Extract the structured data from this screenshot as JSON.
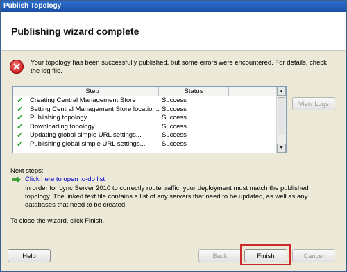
{
  "window": {
    "title": "Publish Topology"
  },
  "header": {
    "title": "Publishing wizard complete"
  },
  "message": "Your topology has been successfully published, but some errors were encountered. For details, check the log file.",
  "table": {
    "columns": [
      "Step",
      "Status"
    ],
    "rows": [
      {
        "step": "Creating Central Management Store",
        "status": "Success"
      },
      {
        "step": "Setting Central Management Store location...",
        "status": "Success"
      },
      {
        "step": "Publishing topology ...",
        "status": "Success"
      },
      {
        "step": "Downloading topology ...",
        "status": "Success"
      },
      {
        "step": "Updating global simple URL settings...",
        "status": "Success"
      },
      {
        "step": "Publishing global simple URL settings...",
        "status": "Success"
      }
    ]
  },
  "buttons": {
    "view_logs": "View Logs",
    "help": "Help",
    "back": "Back",
    "finish": "Finish",
    "cancel": "Cancel"
  },
  "next_steps": {
    "label": "Next steps:",
    "link": "Click here to open to-do list",
    "description": "In order for Lync Server 2010 to correctly route traffic, your deployment must match the published topology. The linked text file contains a list of any servers that need to be updated, as well as any databases that need to be created."
  },
  "close_text": "To close the wizard, click Finish.",
  "icons": {
    "error": "error-icon",
    "check": "checkmark-icon",
    "arrow": "green-arrow-icon"
  },
  "colors": {
    "title_bar": "#1c4fa6",
    "link": "#0000cc",
    "highlight": "#cc2a2a",
    "check": "#1aa11a"
  }
}
